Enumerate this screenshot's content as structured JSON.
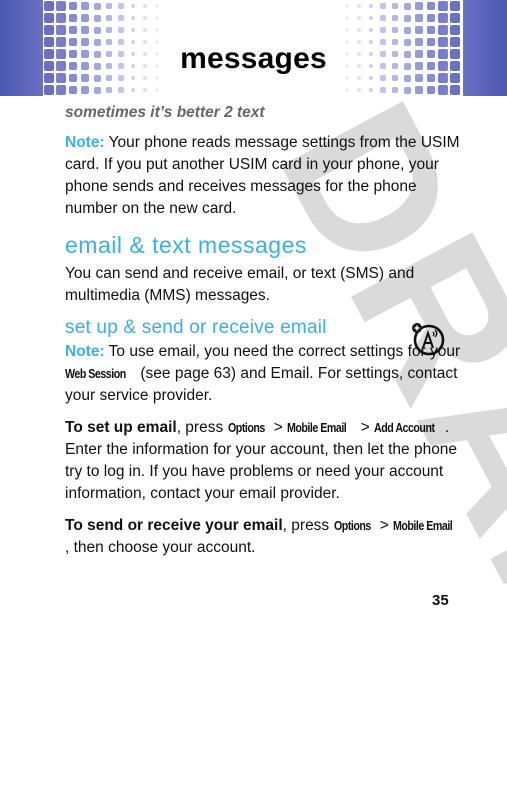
{
  "header": {
    "title": "messages",
    "brand_color": "#5060b8"
  },
  "watermark": "DRAFT",
  "tagline": "sometimes it’s better 2 text",
  "note1": {
    "label": "Note:",
    "text": " Your phone reads message settings from the USIM card. If you put another USIM card in your phone, your phone sends and receives messages for the phone number on the new card."
  },
  "section": {
    "heading": "email & text messages",
    "intro": "You can send and receive email, or text (SMS) and multimedia (MMS) messages."
  },
  "subsection": {
    "heading": "set up & send or receive email",
    "feature_icon": "network-feature-icon"
  },
  "note2": {
    "label": "Note:",
    "text_a": " To use email, you need the correct settings for your ",
    "key": "Web Session",
    "text_b": " (see page 63) and Email. For settings, contact your service provider."
  },
  "setup": {
    "lead": "To set up email",
    "press": ", press ",
    "keys": [
      "Options",
      "Mobile Email",
      "Add Account"
    ],
    "sep": " > ",
    "end": ".",
    "text": " Enter the information for your account, then let the phone try to log in. If you have problems or need your account information, contact your email provider."
  },
  "send": {
    "lead": "To send or receive your email",
    "press": ", press ",
    "keys": [
      "Options",
      "Mobile Email"
    ],
    "sep": " > ",
    "text": ", then choose your account."
  },
  "accent_color": "#3ab0e6",
  "page_number": "35"
}
